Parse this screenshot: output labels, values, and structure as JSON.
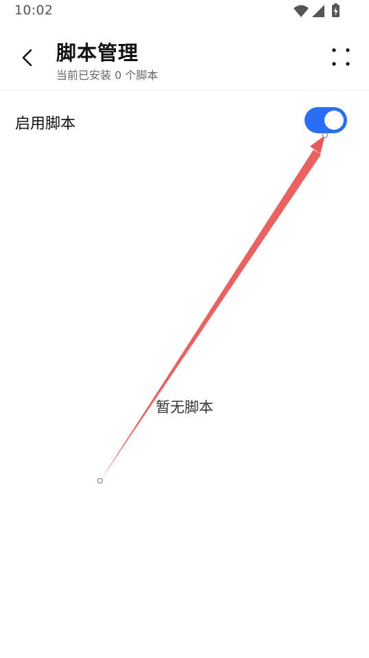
{
  "status_bar": {
    "time": "10:02",
    "icons": [
      "wifi-icon",
      "signal-icon",
      "battery-charging-icon"
    ]
  },
  "header": {
    "back_icon": "chevron-left-icon",
    "title": "脚本管理",
    "subtitle": "当前已安装 0 个脚本",
    "more_icon": "more-dots-icon"
  },
  "settings": {
    "enable_label": "启用脚本",
    "enabled": true
  },
  "empty_state": {
    "text": "暂无脚本"
  },
  "colors": {
    "accent": "#2a6ef6",
    "annotation_arrow": "#e85a5a"
  }
}
